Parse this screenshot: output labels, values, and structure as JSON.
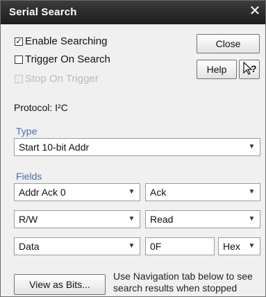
{
  "window": {
    "title": "Serial Search",
    "close_glyph": "✕"
  },
  "options": {
    "enable_searching": {
      "label": "Enable Searching",
      "checked": true
    },
    "trigger_on_search": {
      "label": "Trigger On Search",
      "checked": false
    },
    "stop_on_trigger": {
      "label": "Stop On Trigger",
      "checked": false,
      "enabled": false
    }
  },
  "buttons": {
    "close": "Close",
    "help": "Help",
    "whats_this": "?",
    "view_as_bits": "View as Bits..."
  },
  "protocol": {
    "label": "Protocol: I²C"
  },
  "type": {
    "heading": "Type",
    "selected": "Start 10-bit Addr"
  },
  "fields": {
    "heading": "Fields",
    "row1": {
      "field": "Addr Ack 0",
      "value": "Ack"
    },
    "row2": {
      "field": "R/W",
      "value": "Read"
    },
    "row3": {
      "field": "Data",
      "value": "0F",
      "format": "Hex"
    }
  },
  "note": "Use Navigation tab below to see search results when stopped",
  "icons": {
    "dropdown": "chevron-down-icon",
    "close": "close-icon",
    "help_cursor": "help-cursor-icon"
  }
}
